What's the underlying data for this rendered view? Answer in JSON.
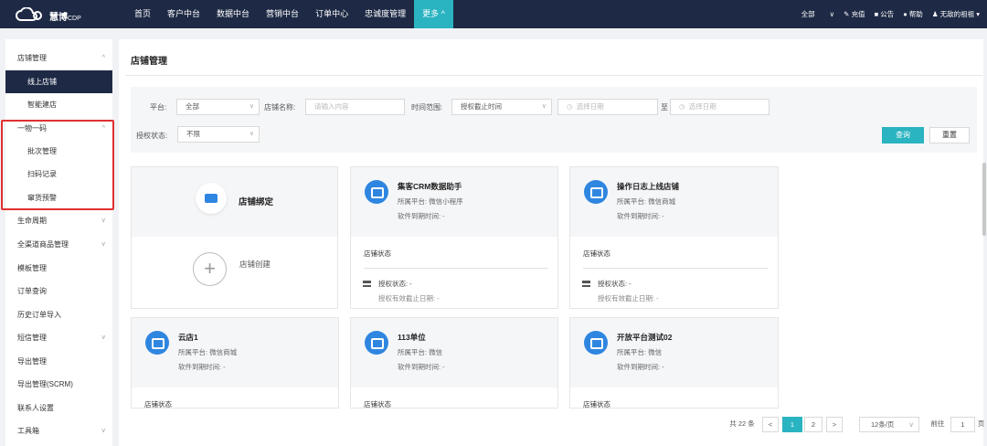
{
  "brand": {
    "name": "慧博",
    "suffix": "CDP"
  },
  "nav": [
    "首页",
    "客户中台",
    "数据中台",
    "营销中台",
    "订单中心",
    "忠诚度管理",
    "更多 ^"
  ],
  "topright": {
    "all": "全部",
    "recharge": "充值",
    "notice": "公告",
    "help": "帮助",
    "user": "无敌的祖祖"
  },
  "sidebar": [
    {
      "label": "店铺管理",
      "chev": "^"
    },
    {
      "label": "线上店铺"
    },
    {
      "label": "智能建店"
    },
    {
      "label": "一物一码",
      "chev": "^"
    },
    {
      "label": "批次管理"
    },
    {
      "label": "扫码记录"
    },
    {
      "label": "窜货预警"
    },
    {
      "label": "生命周期",
      "chev": "v"
    },
    {
      "label": "全渠道商品管理",
      "chev": "v"
    },
    {
      "label": "模板管理"
    },
    {
      "label": "订单查询"
    },
    {
      "label": "历史订单导入"
    },
    {
      "label": "短信管理",
      "chev": "v"
    },
    {
      "label": "导出管理"
    },
    {
      "label": "导出管理(SCRM)"
    },
    {
      "label": "联系人设置"
    },
    {
      "label": "工具箱",
      "chev": "v"
    }
  ],
  "page": {
    "title": "店铺管理"
  },
  "filters": {
    "platform_label": "平台:",
    "platform_value": "全部",
    "store_label": "店铺名称:",
    "store_placeholder": "请输入内容",
    "time_label": "时间范围:",
    "time_value": "授权截止时间",
    "date_start": "选择日期",
    "to": "至",
    "date_end": "选择日期",
    "auth_label": "授权状态:",
    "auth_value": "不限",
    "query": "查询",
    "reset": "重置"
  },
  "binding": {
    "bind_label": "店铺绑定",
    "create_label": "店铺创建"
  },
  "card_text": {
    "platform_prefix": "所属平台:",
    "expire": "软件到期时间: -",
    "status": "店铺状态",
    "auth": "授权状态: -",
    "auth_date": "授权有效截止日期: -"
  },
  "stores": [
    {
      "name": "集客CRM数据助手",
      "platform": "微信小程序"
    },
    {
      "name": "操作日志上线店铺",
      "platform": "微信商城"
    },
    {
      "name": "云店1",
      "platform": "微信商城"
    },
    {
      "name": "113单位",
      "platform": "微信"
    },
    {
      "name": "开放平台测试02",
      "platform": "微信"
    }
  ],
  "pager": {
    "total": "共 22 条",
    "prev": "<",
    "p1": "1",
    "p2": "2",
    "next": ">",
    "size": "12条/页",
    "goto": "前往",
    "page_value": "1",
    "page_unit": "页"
  }
}
